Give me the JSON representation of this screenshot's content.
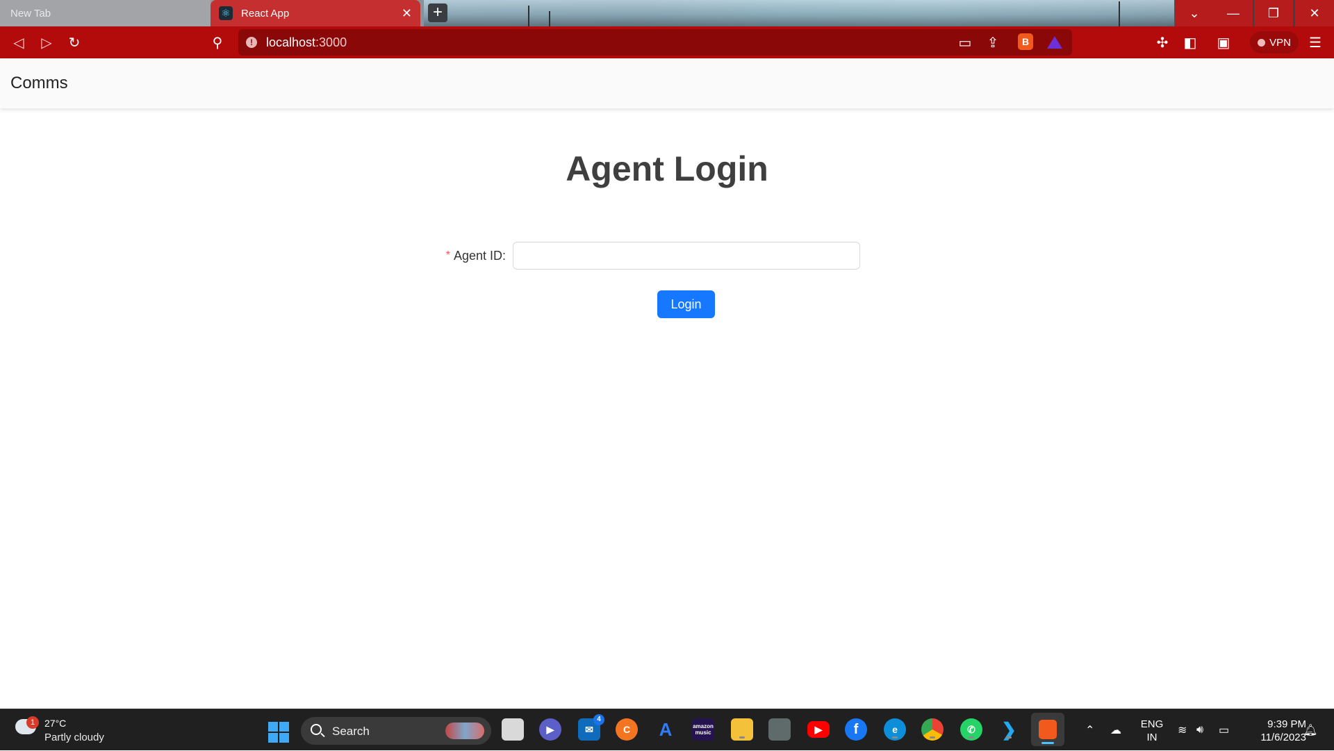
{
  "browser": {
    "tabs": [
      {
        "title": "New Tab",
        "active": false
      },
      {
        "title": "React App",
        "active": true
      }
    ],
    "new_tab_symbol": "+",
    "url": {
      "host": "localhost",
      "port": ":3000"
    },
    "vpn_label": "VPN",
    "icons": {
      "back": "back-icon",
      "forward": "forward-icon",
      "reload": "reload-icon",
      "bookmark": "bookmark-icon",
      "site_info": "info-icon",
      "cast": "cast-icon",
      "share": "share-icon",
      "brave_shields": "brave-lion-icon",
      "rewards": "triangle-icon",
      "extensions": "puzzle-icon",
      "sidebar": "sidebar-icon",
      "wallet": "wallet-icon",
      "menu": "hamburger-icon"
    },
    "colors": {
      "toolbar": "#b30b0b",
      "active_tab": "#c62f2f",
      "urlbar": "#8b0808"
    }
  },
  "app": {
    "brand": "Comms",
    "title": "Agent Login",
    "form": {
      "field_label": "Agent ID",
      "required_mark": "*",
      "value": ""
    },
    "submit_label": "Login",
    "colors": {
      "primary": "#1677ff",
      "required": "#ff4d4f"
    }
  },
  "taskbar": {
    "weather": {
      "temperature": "27°C",
      "condition": "Partly cloudy",
      "badge": "1"
    },
    "search_label": "Search",
    "apps": [
      {
        "name": "file-explorer-window",
        "badge": ""
      },
      {
        "name": "teams",
        "badge": ""
      },
      {
        "name": "mail",
        "badge": "4"
      },
      {
        "name": "crunchyroll",
        "badge": ""
      },
      {
        "name": "app-store",
        "badge": ""
      },
      {
        "name": "amazon-music",
        "label": "amazon music"
      },
      {
        "name": "file-explorer",
        "badge": ""
      },
      {
        "name": "photos",
        "badge": ""
      },
      {
        "name": "youtube",
        "badge": ""
      },
      {
        "name": "facebook",
        "badge": ""
      },
      {
        "name": "edge",
        "badge": ""
      },
      {
        "name": "chrome",
        "badge": ""
      },
      {
        "name": "whatsapp",
        "badge": ""
      },
      {
        "name": "vscode",
        "badge": ""
      },
      {
        "name": "brave",
        "badge": ""
      }
    ],
    "language": {
      "line1": "ENG",
      "line2": "IN"
    },
    "clock": {
      "time": "9:39 PM",
      "date": "11/6/2023"
    }
  }
}
